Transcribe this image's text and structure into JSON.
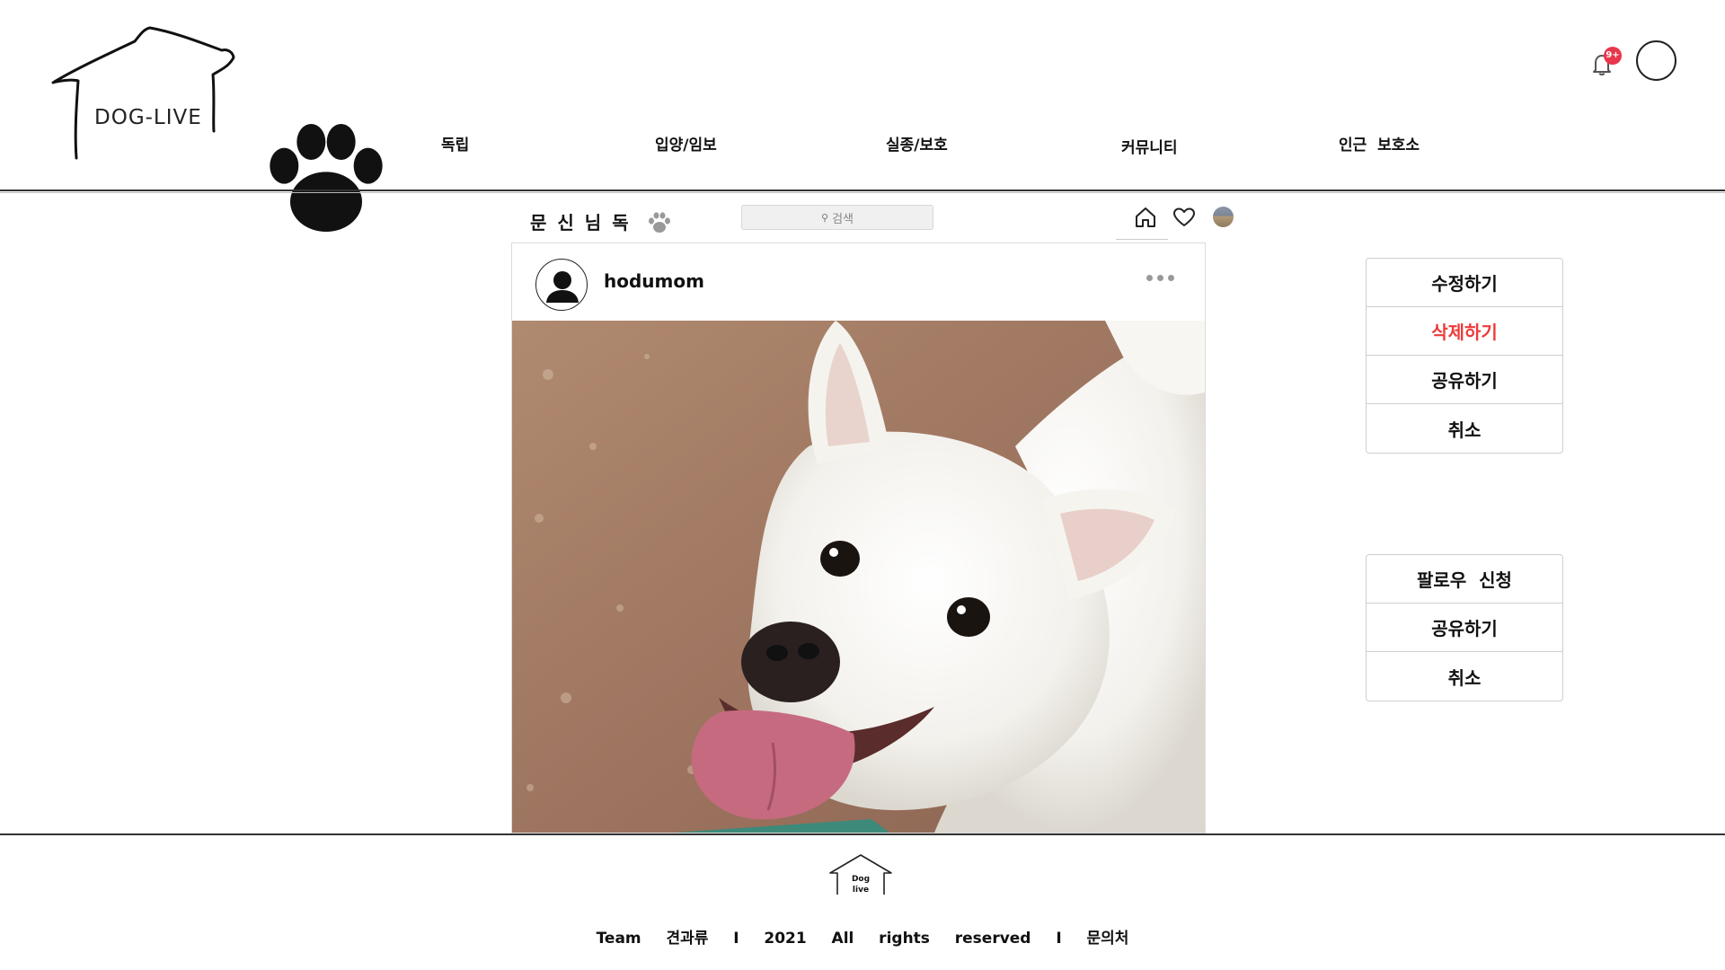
{
  "header": {
    "logo_text": "DOG-LIVE",
    "nav": [
      {
        "label": "독립"
      },
      {
        "label": "입양/임보"
      },
      {
        "label": "실종/보호"
      },
      {
        "label": "커뮤니티"
      },
      {
        "label": "인근  보호소"
      }
    ],
    "notification_badge": "9+"
  },
  "feed_bar": {
    "brand": "문신님독",
    "search_placeholder": "검색"
  },
  "post": {
    "username": "hodumom"
  },
  "owner_menu": {
    "items": [
      {
        "label": "수정하기",
        "color": "#111111"
      },
      {
        "label": "삭제하기",
        "color": "#ed3b3b"
      },
      {
        "label": "공유하기",
        "color": "#111111"
      },
      {
        "label": "취소",
        "color": "#111111"
      }
    ]
  },
  "visitor_menu": {
    "items": [
      {
        "label": "팔로우  신청"
      },
      {
        "label": "공유하기"
      },
      {
        "label": "취소"
      }
    ]
  },
  "footer": {
    "logo_line1": "Dog",
    "logo_line2": "live",
    "text": "Team  견과류  I  2021  All  rights  reserved  I  문의처"
  },
  "colors": {
    "accent_red": "#ed3b3b",
    "badge_red": "#e8364a",
    "line": "#333333"
  }
}
